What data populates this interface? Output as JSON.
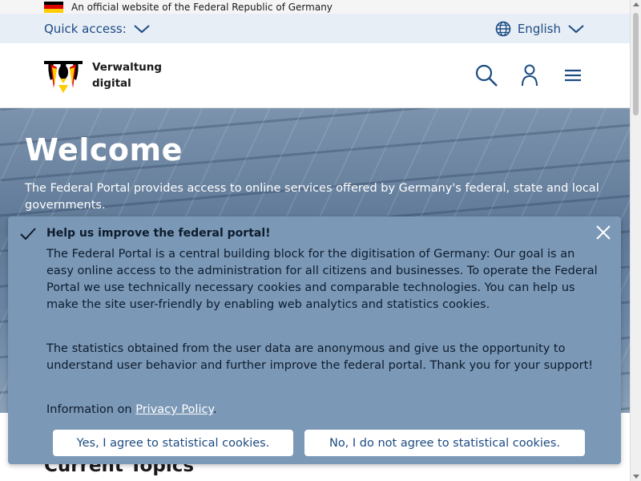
{
  "official_bar": {
    "text": "An official website of the Federal Republic of Germany",
    "flag_colors": [
      "#000000",
      "#dd0000",
      "#ffcc00"
    ]
  },
  "quick_bar": {
    "quick_access_label": "Quick access:",
    "language_label": "English"
  },
  "header": {
    "logo_line1": "Verwaltung",
    "logo_line2": "digital",
    "icons": [
      "search-icon",
      "user-icon",
      "menu-icon"
    ]
  },
  "hero": {
    "title": "Welcome",
    "text": "The Federal Portal provides access to online services offered by Germany's federal, state and local governments."
  },
  "topics": {
    "heading": "Current Topics"
  },
  "cookie_banner": {
    "title": "Help us improve the federal portal!",
    "paragraph1": "The Federal Portal is a central building block for the digitisation of Germany: Our goal is an easy online access to the administration for all citizens and businesses. To operate the Federal Portal we use technically necessary cookies and comparable technologies. You can help us make the site user-friendly by enabling web analytics and statistics cookies.",
    "paragraph2": "The statistics obtained from the user data are anonymous and give us the opportunity to understand user behavior and further improve the federal portal. Thank you for your support!",
    "info_prefix": "Information on ",
    "privacy_link": "Privacy Policy",
    "info_suffix": ".",
    "accept_label": "Yes, I agree to statistical cookies.",
    "decline_label": "No, I do not agree to statistical cookies."
  },
  "colors": {
    "brand_blue": "#1c4b82",
    "quick_bar_bg": "#e8eef6",
    "cookie_bg": "#7b98b7"
  }
}
